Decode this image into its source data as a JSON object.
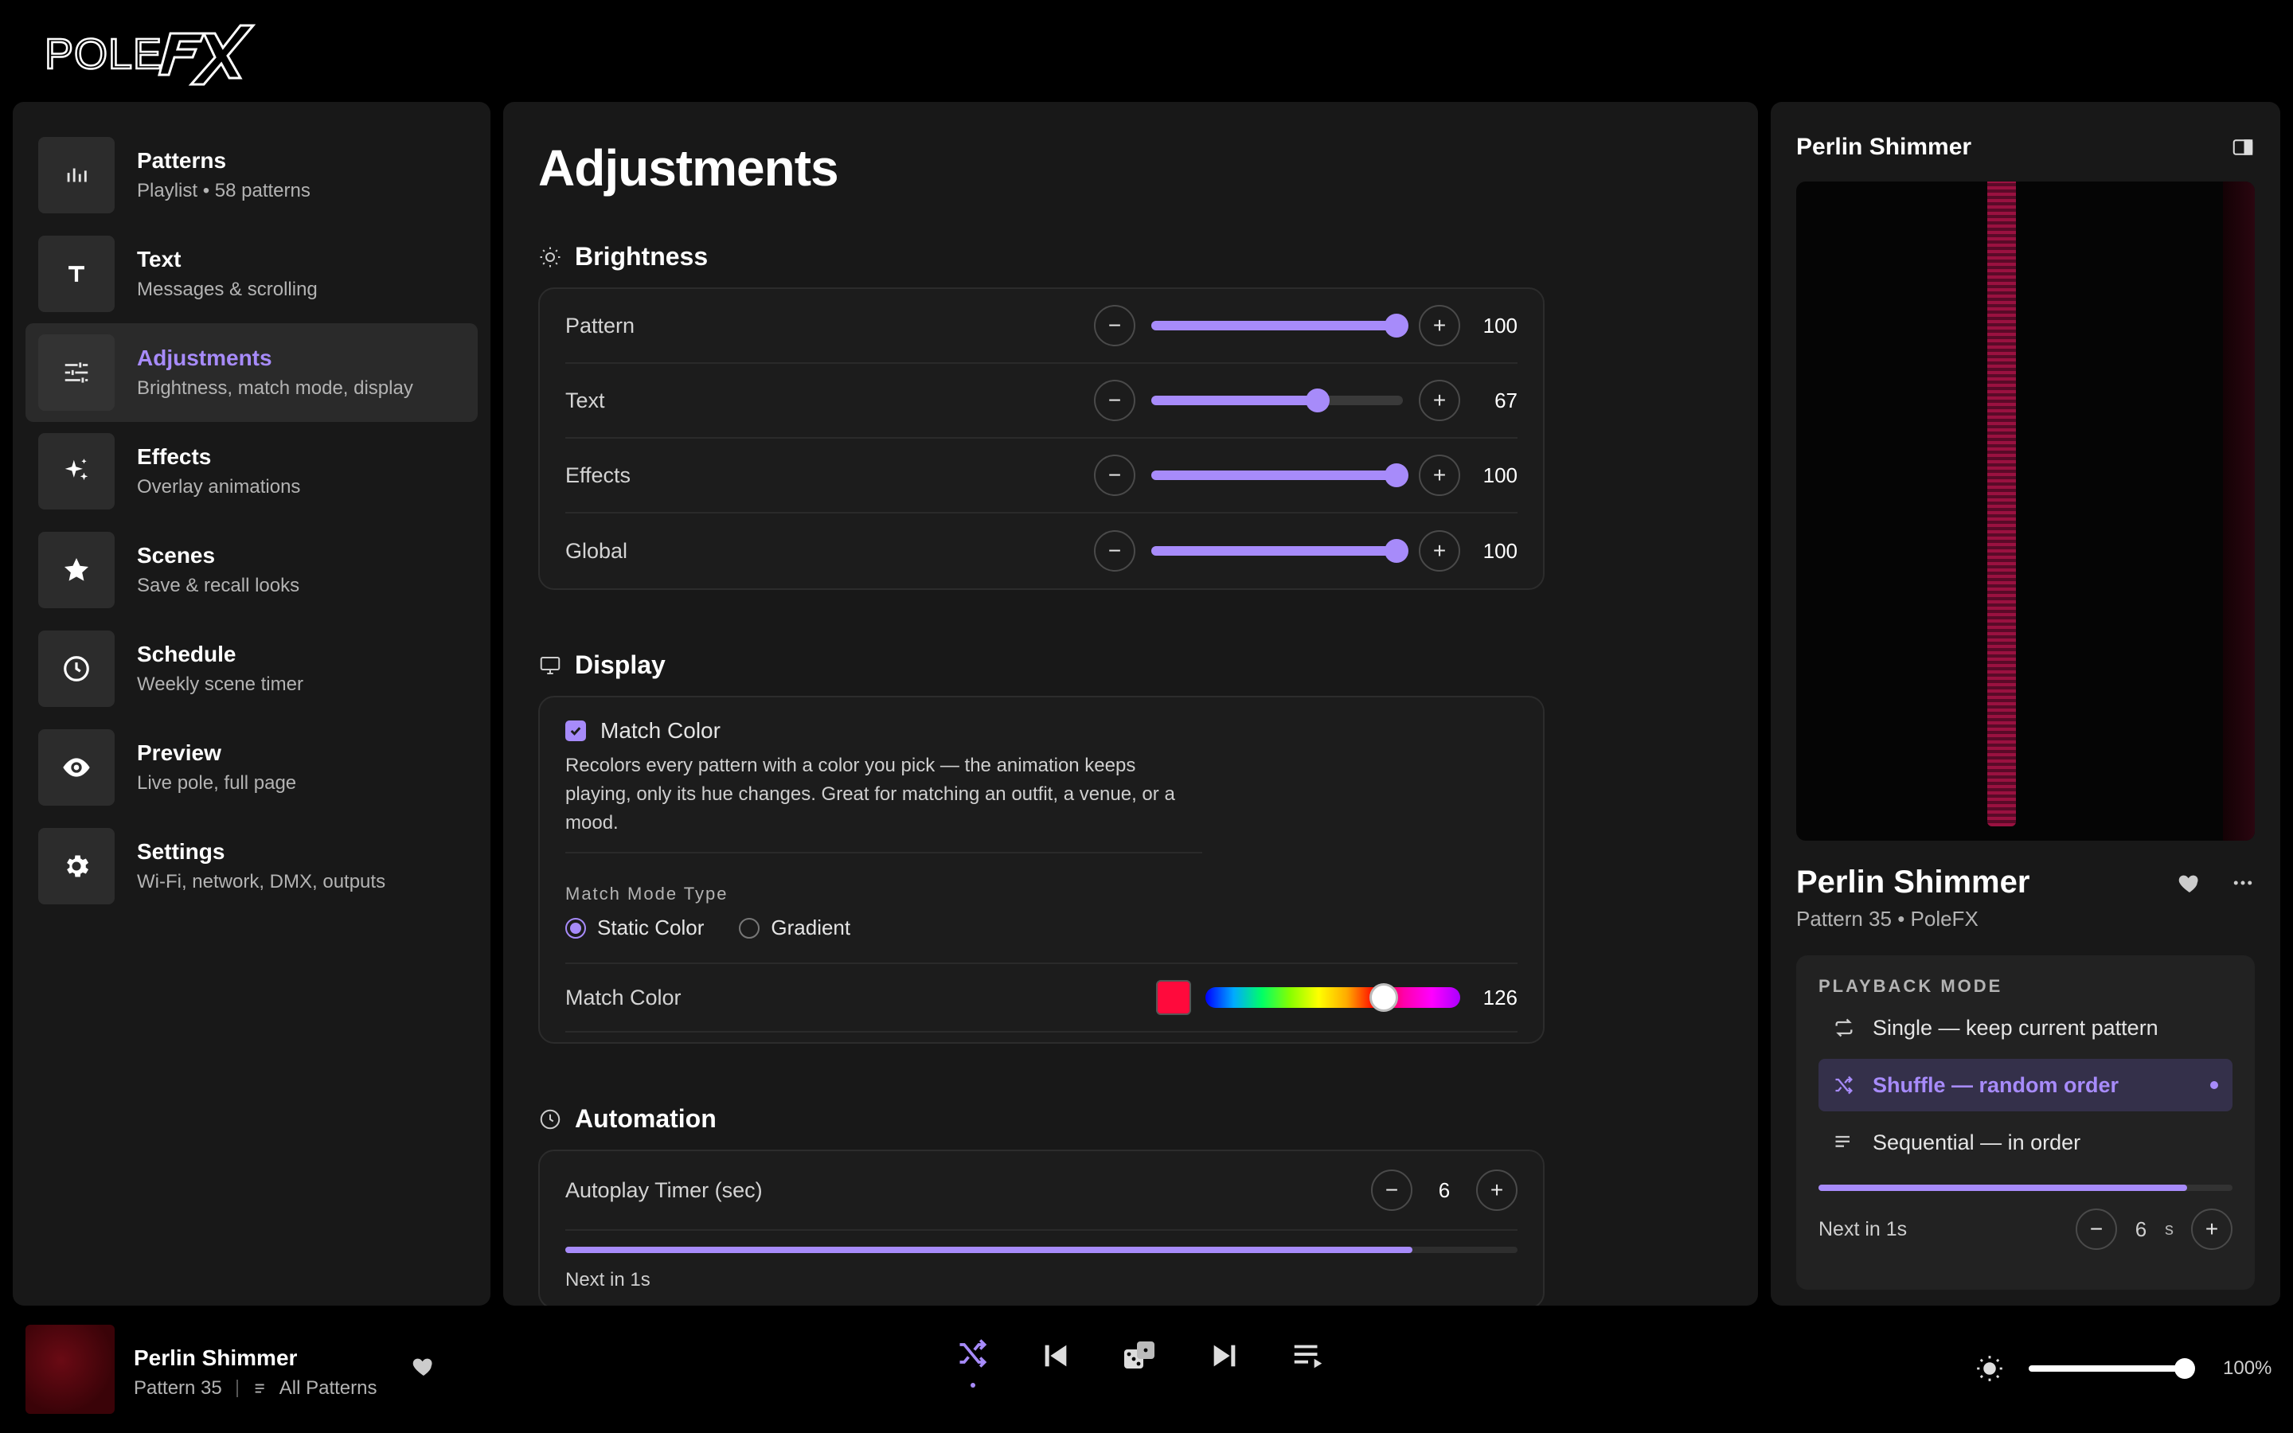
{
  "app": {
    "logo_text": "POLEFX",
    "accent": "#a78bfa"
  },
  "sidebar": {
    "items": [
      {
        "title": "Patterns",
        "sub": "Playlist • 58 patterns",
        "icon": "bar-chart-icon"
      },
      {
        "title": "Text",
        "sub": "Messages & scrolling",
        "icon": "text-icon"
      },
      {
        "title": "Adjustments",
        "sub": "Brightness, match mode, display",
        "icon": "sliders-icon"
      },
      {
        "title": "Effects",
        "sub": "Overlay animations",
        "icon": "sparkles-icon"
      },
      {
        "title": "Scenes",
        "sub": "Save & recall looks",
        "icon": "star-icon"
      },
      {
        "title": "Schedule",
        "sub": "Weekly scene timer",
        "icon": "clock-icon"
      },
      {
        "title": "Preview",
        "sub": "Live pole, full page",
        "icon": "eye-icon"
      },
      {
        "title": "Settings",
        "sub": "Wi-Fi, network, DMX, outputs",
        "icon": "gear-icon"
      }
    ],
    "active_index": 2
  },
  "main": {
    "title": "Adjustments",
    "brightness": {
      "heading": "Brightness",
      "rows": [
        {
          "label": "Pattern",
          "value": 100,
          "max": 100
        },
        {
          "label": "Text",
          "value": 67,
          "max": 100
        },
        {
          "label": "Effects",
          "value": 100,
          "max": 100
        },
        {
          "label": "Global",
          "value": 100,
          "max": 100
        }
      ]
    },
    "display": {
      "heading": "Display",
      "match_color_label": "Match Color",
      "match_color_checked": true,
      "description": "Recolors every pattern with a color you pick — the animation keeps playing, only its hue changes. Great for matching an outfit, a venue, or a mood.",
      "mode_type_label": "Match Mode Type",
      "mode_options": [
        "Static Color",
        "Gradient"
      ],
      "mode_selected": "Static Color",
      "color_row_label": "Match Color",
      "swatch_color": "#ff0a3c",
      "hue_value": 126,
      "hue_max": 180
    },
    "automation": {
      "heading": "Automation",
      "timer_label": "Autoplay Timer (sec)",
      "timer_value": "6",
      "progress": 0.89,
      "next_in": "Next in 1s"
    }
  },
  "right": {
    "header_title": "Perlin Shimmer",
    "pattern_title": "Perlin Shimmer",
    "pattern_sub": "Pattern 35 • PoleFX",
    "playback": {
      "label": "PLAYBACK MODE",
      "options": [
        {
          "label": "Single — keep current pattern",
          "icon": "repeat-icon"
        },
        {
          "label": "Shuffle — random order",
          "icon": "shuffle-icon"
        },
        {
          "label": "Sequential — in order",
          "icon": "list-icon"
        }
      ],
      "active_index": 1,
      "progress": 0.89,
      "next_in": "Next in 1s",
      "timer_value": "6",
      "timer_unit": "s"
    }
  },
  "bottom": {
    "title": "Perlin Shimmer",
    "pattern": "Pattern 35",
    "playlist": "All Patterns",
    "brightness_value": "100%",
    "brightness_fraction": 1.0
  }
}
